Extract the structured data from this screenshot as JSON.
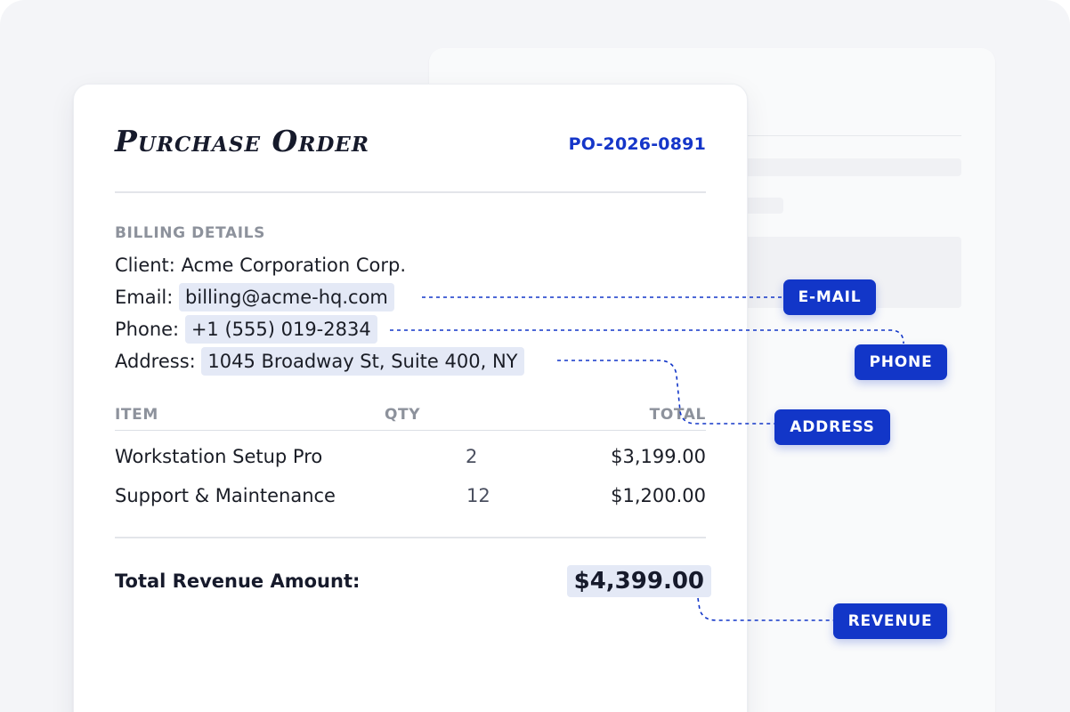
{
  "document": {
    "title": "Purchase Order",
    "po_number": "PO-2026-0891",
    "billing": {
      "section_label": "BILLING DETAILS",
      "client_label": "Client:",
      "client_value": "Acme Corporation Corp.",
      "email_label": "Email:",
      "email_value": "billing@acme-hq.com",
      "phone_label": "Phone:",
      "phone_value": "+1 (555) 019-2834",
      "address_label": "Address:",
      "address_value": "1045 Broadway St, Suite 400, NY"
    },
    "table": {
      "headers": {
        "item": "ITEM",
        "qty": "QTY",
        "total": "TOTAL"
      },
      "rows": [
        {
          "item": "Workstation Setup Pro",
          "qty": "2",
          "total": "$3,199.00"
        },
        {
          "item": "Support & Maintenance",
          "qty": "12",
          "total": "$1,200.00"
        }
      ]
    },
    "summary": {
      "label": "Total Revenue Amount:",
      "value": "$4,399.00"
    }
  },
  "annotations": {
    "email": "E-MAIL",
    "phone": "PHONE",
    "address": "ADDRESS",
    "revenue": "REVENUE"
  },
  "colors": {
    "accent": "#1236c8",
    "highlight": "#e4e9f6",
    "muted_text": "#8d929c"
  }
}
